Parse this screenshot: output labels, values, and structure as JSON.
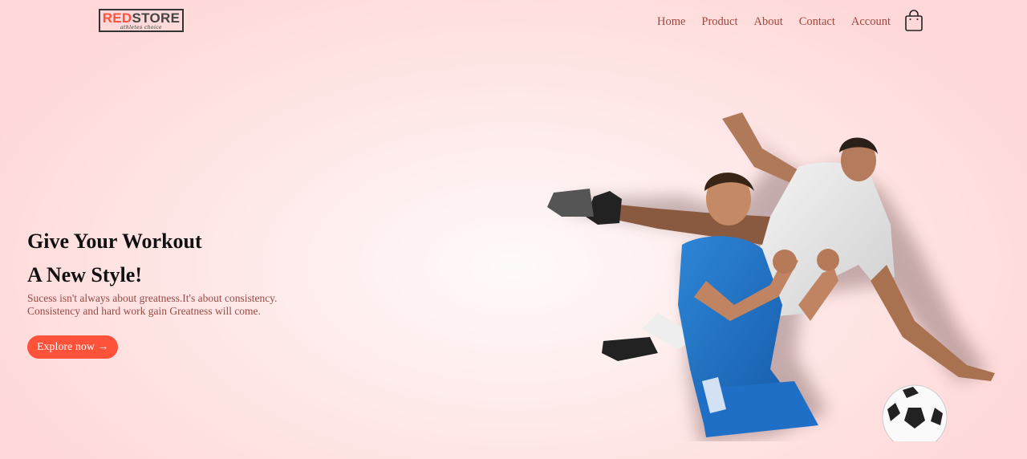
{
  "logo": {
    "word_red": "RED",
    "word_dark": "STORE",
    "tagline": "athletes choice"
  },
  "nav": {
    "items": [
      "Home",
      "Product",
      "About",
      "Contact",
      "Account"
    ]
  },
  "cart": {
    "icon": "shopping-bag-icon"
  },
  "hero": {
    "title_line1": "Give Your Workout",
    "title_line2": "A New Style!",
    "subtitle_line1": "Sucess isn't always about greatness.It's about consistency.",
    "subtitle_line2": "Consistency and hard work gain Greatness will come.",
    "button_label": "Explore now →",
    "image_icon": "football-players-illustration"
  },
  "colors": {
    "accent": "#ff523b",
    "nav_text": "#a1463c",
    "background": "#ffe3e3"
  }
}
